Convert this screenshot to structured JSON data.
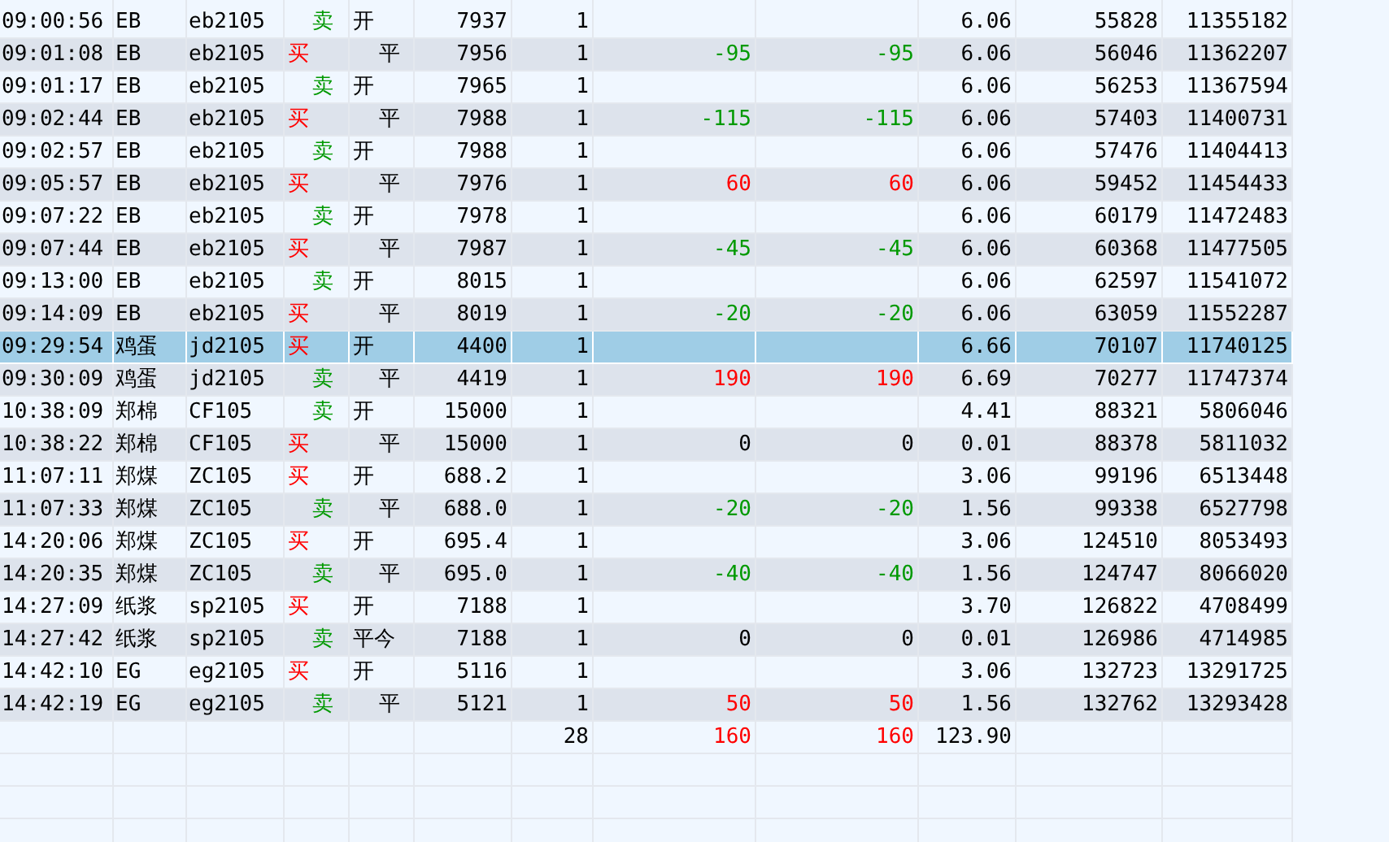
{
  "rows": [
    {
      "time": "09:00:56",
      "name": "EB",
      "code": "eb2105",
      "side": {
        "kind": "sell",
        "text": "卖"
      },
      "offset": {
        "kind": "open",
        "text": "开"
      },
      "price": "7937",
      "qty": "1",
      "pnl_1": null,
      "pnl_2": null,
      "fee": "6.06",
      "column_11": "55828",
      "column_12": "11355182",
      "selected": false
    },
    {
      "time": "09:01:08",
      "name": "EB",
      "code": "eb2105",
      "side": {
        "kind": "buy",
        "text": "买"
      },
      "offset": {
        "kind": "close",
        "text": "平"
      },
      "price": "7956",
      "qty": "1",
      "pnl_1": {
        "text": "-95",
        "color": "#009900"
      },
      "pnl_2": {
        "text": "-95",
        "color": "#009900"
      },
      "fee": "6.06",
      "column_11": "56046",
      "column_12": "11362207",
      "selected": false
    },
    {
      "time": "09:01:17",
      "name": "EB",
      "code": "eb2105",
      "side": {
        "kind": "sell",
        "text": "卖"
      },
      "offset": {
        "kind": "open",
        "text": "开"
      },
      "price": "7965",
      "qty": "1",
      "pnl_1": null,
      "pnl_2": null,
      "fee": "6.06",
      "column_11": "56253",
      "column_12": "11367594",
      "selected": false
    },
    {
      "time": "09:02:44",
      "name": "EB",
      "code": "eb2105",
      "side": {
        "kind": "buy",
        "text": "买"
      },
      "offset": {
        "kind": "close",
        "text": "平"
      },
      "price": "7988",
      "qty": "1",
      "pnl_1": {
        "text": "-115",
        "color": "#009900"
      },
      "pnl_2": {
        "text": "-115",
        "color": "#009900"
      },
      "fee": "6.06",
      "column_11": "57403",
      "column_12": "11400731",
      "selected": false
    },
    {
      "time": "09:02:57",
      "name": "EB",
      "code": "eb2105",
      "side": {
        "kind": "sell",
        "text": "卖"
      },
      "offset": {
        "kind": "open",
        "text": "开"
      },
      "price": "7988",
      "qty": "1",
      "pnl_1": null,
      "pnl_2": null,
      "fee": "6.06",
      "column_11": "57476",
      "column_12": "11404413",
      "selected": false
    },
    {
      "time": "09:05:57",
      "name": "EB",
      "code": "eb2105",
      "side": {
        "kind": "buy",
        "text": "买"
      },
      "offset": {
        "kind": "close",
        "text": "平"
      },
      "price": "7976",
      "qty": "1",
      "pnl_1": {
        "text": "60",
        "color": "#ff0000"
      },
      "pnl_2": {
        "text": "60",
        "color": "#ff0000"
      },
      "fee": "6.06",
      "column_11": "59452",
      "column_12": "11454433",
      "selected": false
    },
    {
      "time": "09:07:22",
      "name": "EB",
      "code": "eb2105",
      "side": {
        "kind": "sell",
        "text": "卖"
      },
      "offset": {
        "kind": "open",
        "text": "开"
      },
      "price": "7978",
      "qty": "1",
      "pnl_1": null,
      "pnl_2": null,
      "fee": "6.06",
      "column_11": "60179",
      "column_12": "11472483",
      "selected": false
    },
    {
      "time": "09:07:44",
      "name": "EB",
      "code": "eb2105",
      "side": {
        "kind": "buy",
        "text": "买"
      },
      "offset": {
        "kind": "close",
        "text": "平"
      },
      "price": "7987",
      "qty": "1",
      "pnl_1": {
        "text": "-45",
        "color": "#009900"
      },
      "pnl_2": {
        "text": "-45",
        "color": "#009900"
      },
      "fee": "6.06",
      "column_11": "60368",
      "column_12": "11477505",
      "selected": false
    },
    {
      "time": "09:13:00",
      "name": "EB",
      "code": "eb2105",
      "side": {
        "kind": "sell",
        "text": "卖"
      },
      "offset": {
        "kind": "open",
        "text": "开"
      },
      "price": "8015",
      "qty": "1",
      "pnl_1": null,
      "pnl_2": null,
      "fee": "6.06",
      "column_11": "62597",
      "column_12": "11541072",
      "selected": false
    },
    {
      "time": "09:14:09",
      "name": "EB",
      "code": "eb2105",
      "side": {
        "kind": "buy",
        "text": "买"
      },
      "offset": {
        "kind": "close",
        "text": "平"
      },
      "price": "8019",
      "qty": "1",
      "pnl_1": {
        "text": "-20",
        "color": "#009900"
      },
      "pnl_2": {
        "text": "-20",
        "color": "#009900"
      },
      "fee": "6.06",
      "column_11": "63059",
      "column_12": "11552287",
      "selected": false
    },
    {
      "time": "09:29:54",
      "name": "鸡蛋",
      "code": "jd2105",
      "side": {
        "kind": "buy",
        "text": "买"
      },
      "offset": {
        "kind": "open",
        "text": "开"
      },
      "price": "4400",
      "qty": "1",
      "pnl_1": null,
      "pnl_2": null,
      "fee": "6.66",
      "column_11": "70107",
      "column_12": "11740125",
      "selected": true
    },
    {
      "time": "09:30:09",
      "name": "鸡蛋",
      "code": "jd2105",
      "side": {
        "kind": "sell",
        "text": "卖"
      },
      "offset": {
        "kind": "close",
        "text": "平"
      },
      "price": "4419",
      "qty": "1",
      "pnl_1": {
        "text": "190",
        "color": "#ff0000"
      },
      "pnl_2": {
        "text": "190",
        "color": "#ff0000"
      },
      "fee": "6.69",
      "column_11": "70277",
      "column_12": "11747374",
      "selected": false
    },
    {
      "time": "10:38:09",
      "name": "郑棉",
      "code": "CF105",
      "side": {
        "kind": "sell",
        "text": "卖"
      },
      "offset": {
        "kind": "open",
        "text": "开"
      },
      "price": "15000",
      "qty": "1",
      "pnl_1": null,
      "pnl_2": null,
      "fee": "4.41",
      "column_11": "88321",
      "column_12": "5806046",
      "selected": false
    },
    {
      "time": "10:38:22",
      "name": "郑棉",
      "code": "CF105",
      "side": {
        "kind": "buy",
        "text": "买"
      },
      "offset": {
        "kind": "close",
        "text": "平"
      },
      "price": "15000",
      "qty": "1",
      "pnl_1": {
        "text": "0",
        "color": "#000000"
      },
      "pnl_2": {
        "text": "0",
        "color": "#000000"
      },
      "fee": "0.01",
      "column_11": "88378",
      "column_12": "5811032",
      "selected": false
    },
    {
      "time": "11:07:11",
      "name": "郑煤",
      "code": "ZC105",
      "side": {
        "kind": "buy",
        "text": "买"
      },
      "offset": {
        "kind": "open",
        "text": "开"
      },
      "price": "688.2",
      "qty": "1",
      "pnl_1": null,
      "pnl_2": null,
      "fee": "3.06",
      "column_11": "99196",
      "column_12": "6513448",
      "selected": false
    },
    {
      "time": "11:07:33",
      "name": "郑煤",
      "code": "ZC105",
      "side": {
        "kind": "sell",
        "text": "卖"
      },
      "offset": {
        "kind": "close",
        "text": "平"
      },
      "price": "688.0",
      "qty": "1",
      "pnl_1": {
        "text": "-20",
        "color": "#009900"
      },
      "pnl_2": {
        "text": "-20",
        "color": "#009900"
      },
      "fee": "1.56",
      "column_11": "99338",
      "column_12": "6527798",
      "selected": false
    },
    {
      "time": "14:20:06",
      "name": "郑煤",
      "code": "ZC105",
      "side": {
        "kind": "buy",
        "text": "买"
      },
      "offset": {
        "kind": "open",
        "text": "开"
      },
      "price": "695.4",
      "qty": "1",
      "pnl_1": null,
      "pnl_2": null,
      "fee": "3.06",
      "column_11": "124510",
      "column_12": "8053493",
      "selected": false
    },
    {
      "time": "14:20:35",
      "name": "郑煤",
      "code": "ZC105",
      "side": {
        "kind": "sell",
        "text": "卖"
      },
      "offset": {
        "kind": "close",
        "text": "平"
      },
      "price": "695.0",
      "qty": "1",
      "pnl_1": {
        "text": "-40",
        "color": "#009900"
      },
      "pnl_2": {
        "text": "-40",
        "color": "#009900"
      },
      "fee": "1.56",
      "column_11": "124747",
      "column_12": "8066020",
      "selected": false
    },
    {
      "time": "14:27:09",
      "name": "纸浆",
      "code": "sp2105",
      "side": {
        "kind": "buy",
        "text": "买"
      },
      "offset": {
        "kind": "open",
        "text": "开"
      },
      "price": "7188",
      "qty": "1",
      "pnl_1": null,
      "pnl_2": null,
      "fee": "3.70",
      "column_11": "126822",
      "column_12": "4708499",
      "selected": false
    },
    {
      "time": "14:27:42",
      "name": "纸浆",
      "code": "sp2105",
      "side": {
        "kind": "sell",
        "text": "卖"
      },
      "offset": {
        "kind": "close_today",
        "text": "平今"
      },
      "price": "7188",
      "qty": "1",
      "pnl_1": {
        "text": "0",
        "color": "#000000"
      },
      "pnl_2": {
        "text": "0",
        "color": "#000000"
      },
      "fee": "0.01",
      "column_11": "126986",
      "column_12": "4714985",
      "selected": false
    },
    {
      "time": "14:42:10",
      "name": "EG",
      "code": "eg2105",
      "side": {
        "kind": "buy",
        "text": "买"
      },
      "offset": {
        "kind": "open",
        "text": "开"
      },
      "price": "5116",
      "qty": "1",
      "pnl_1": null,
      "pnl_2": null,
      "fee": "3.06",
      "column_11": "132723",
      "column_12": "13291725",
      "selected": false
    },
    {
      "time": "14:42:19",
      "name": "EG",
      "code": "eg2105",
      "side": {
        "kind": "sell",
        "text": "卖"
      },
      "offset": {
        "kind": "close",
        "text": "平"
      },
      "price": "5121",
      "qty": "1",
      "pnl_1": {
        "text": "50",
        "color": "#ff0000"
      },
      "pnl_2": {
        "text": "50",
        "color": "#ff0000"
      },
      "fee": "1.56",
      "column_11": "132762",
      "column_12": "13293428",
      "selected": false
    }
  ],
  "totals": {
    "qty": "28",
    "pnl_1": {
      "text": "160",
      "color": "#ff0000"
    },
    "pnl_2": {
      "text": "160",
      "color": "#ff0000"
    },
    "fee": "123.90"
  }
}
